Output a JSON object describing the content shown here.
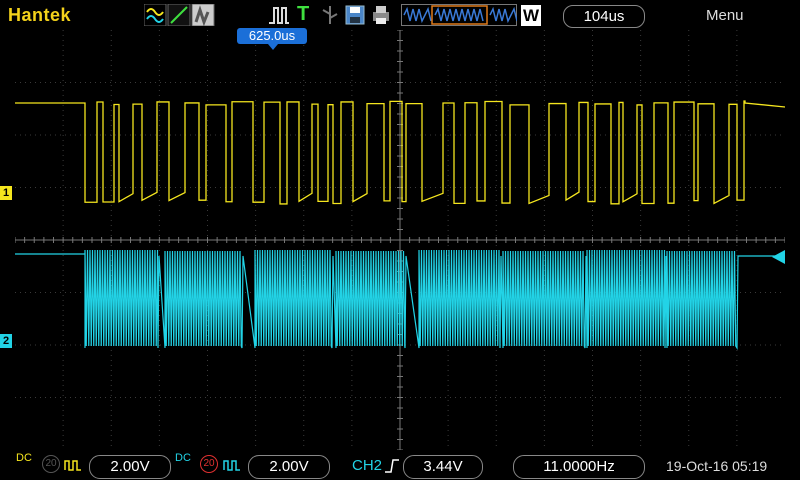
{
  "header": {
    "brand": "Hantek",
    "run_state_icon": "pulse-trigger-icon",
    "trigger_letter": "T",
    "acq_mode_label": "W",
    "timebase": "104us",
    "menu_label": "Menu"
  },
  "trigger_position_label": "625.0us",
  "channels": {
    "ch1": {
      "tag": "1",
      "coupling": "DC",
      "bw_label": "20",
      "volts_div": "2.00V",
      "color": "#f5e61e"
    },
    "ch2": {
      "tag": "2",
      "coupling": "DC",
      "bw_label": "20",
      "volts_div": "2.00V",
      "color": "#22d3e6"
    }
  },
  "trigger": {
    "source": "CH2",
    "level": "3.44V",
    "frequency": "11.0000Hz"
  },
  "datetime": "19-Oct-16 05:19",
  "colors": {
    "brand": "#f3d21b",
    "ch1": "#f5e61e",
    "ch2": "#22d3e6",
    "marker": "#1b6fd8",
    "grid": "#3a3a3a"
  }
}
